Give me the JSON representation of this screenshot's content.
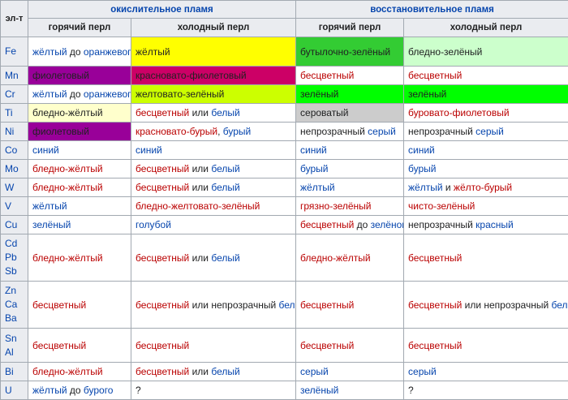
{
  "headers": {
    "element": "эл-т",
    "oxidizing": "окислительное пламя",
    "reducing": "восстановительное пламя",
    "hot": "горячий перл",
    "cold": "холодный перл"
  },
  "rows": [
    {
      "el": [
        "Fe"
      ],
      "h": 36,
      "cells": [
        {
          "bg": "#ffffff",
          "parts": [
            {
              "t": "жёлтый",
              "c": "b"
            },
            {
              "t": " до ",
              "c": "k"
            },
            {
              "t": "оранжевого",
              "c": "b"
            }
          ]
        },
        {
          "bg": "#ffff00",
          "parts": [
            {
              "t": "жёлтый",
              "c": "k"
            }
          ]
        },
        {
          "bg": "#33cc33",
          "parts": [
            {
              "t": "бутылочно-зелёный",
              "c": "k"
            }
          ]
        },
        {
          "bg": "#ccffcc",
          "parts": [
            {
              "t": "бледно-зелёный",
              "c": "k"
            }
          ]
        }
      ]
    },
    {
      "el": [
        "Mn"
      ],
      "h": 23,
      "cells": [
        {
          "bg": "#990099",
          "parts": [
            {
              "t": "фиолетовый",
              "c": "k"
            }
          ]
        },
        {
          "bg": "#cc0066",
          "parts": [
            {
              "t": "красновато-фиолетовый",
              "c": "k"
            }
          ]
        },
        {
          "bg": "#ffffff",
          "parts": [
            {
              "t": "бесцветный",
              "c": "r"
            }
          ]
        },
        {
          "bg": "#ffffff",
          "parts": [
            {
              "t": "бесцветный",
              "c": "r"
            }
          ]
        }
      ]
    },
    {
      "el": [
        "Cr"
      ],
      "h": 23,
      "cells": [
        {
          "bg": "#ffffff",
          "parts": [
            {
              "t": "жёлтый",
              "c": "b"
            },
            {
              "t": " до ",
              "c": "k"
            },
            {
              "t": "оранжевого",
              "c": "b"
            }
          ]
        },
        {
          "bg": "#ccff00",
          "parts": [
            {
              "t": "желтовато-зелёный",
              "c": "k"
            }
          ]
        },
        {
          "bg": "#00ff00",
          "parts": [
            {
              "t": "зелёный",
              "c": "k"
            }
          ]
        },
        {
          "bg": "#00ff00",
          "parts": [
            {
              "t": "зелёный",
              "c": "k"
            }
          ]
        }
      ]
    },
    {
      "el": [
        "Ti"
      ],
      "h": 23,
      "cells": [
        {
          "bg": "#ffffcc",
          "parts": [
            {
              "t": "бледно-жёлтый",
              "c": "k"
            }
          ]
        },
        {
          "bg": "#ffffff",
          "parts": [
            {
              "t": "бесцветный",
              "c": "r"
            },
            {
              "t": " или ",
              "c": "k"
            },
            {
              "t": "белый",
              "c": "b"
            }
          ]
        },
        {
          "bg": "#cccccc",
          "parts": [
            {
              "t": "сероватый",
              "c": "k"
            }
          ]
        },
        {
          "bg": "#ffffff",
          "parts": [
            {
              "t": "буровато-фиолетовый",
              "c": "r"
            }
          ]
        }
      ]
    },
    {
      "el": [
        "Ni"
      ],
      "h": 23,
      "cells": [
        {
          "bg": "#990099",
          "parts": [
            {
              "t": "фиолетовый",
              "c": "k"
            }
          ]
        },
        {
          "bg": "#ffffff",
          "parts": [
            {
              "t": "красновато-бурый",
              "c": "r"
            },
            {
              "t": ", ",
              "c": "k"
            },
            {
              "t": "бурый",
              "c": "b"
            }
          ]
        },
        {
          "bg": "#ffffff",
          "parts": [
            {
              "t": "непрозрачный ",
              "c": "k"
            },
            {
              "t": "серый",
              "c": "b"
            }
          ]
        },
        {
          "bg": "#ffffff",
          "parts": [
            {
              "t": "непрозрачный ",
              "c": "k"
            },
            {
              "t": "серый",
              "c": "b"
            }
          ]
        }
      ]
    },
    {
      "el": [
        "Co"
      ],
      "h": 23,
      "cells": [
        {
          "bg": "#ffffff",
          "parts": [
            {
              "t": "синий",
              "c": "b"
            }
          ]
        },
        {
          "bg": "#ffffff",
          "parts": [
            {
              "t": "синий",
              "c": "b"
            }
          ]
        },
        {
          "bg": "#ffffff",
          "parts": [
            {
              "t": "синий",
              "c": "b"
            }
          ]
        },
        {
          "bg": "#ffffff",
          "parts": [
            {
              "t": "синий",
              "c": "b"
            }
          ]
        }
      ]
    },
    {
      "el": [
        "Mo"
      ],
      "h": 23,
      "cells": [
        {
          "bg": "#ffffff",
          "parts": [
            {
              "t": "бледно-жёлтый",
              "c": "r"
            }
          ]
        },
        {
          "bg": "#ffffff",
          "parts": [
            {
              "t": "бесцветный",
              "c": "r"
            },
            {
              "t": " или ",
              "c": "k"
            },
            {
              "t": "белый",
              "c": "b"
            }
          ]
        },
        {
          "bg": "#ffffff",
          "parts": [
            {
              "t": "бурый",
              "c": "b"
            }
          ]
        },
        {
          "bg": "#ffffff",
          "parts": [
            {
              "t": "бурый",
              "c": "b"
            }
          ]
        }
      ]
    },
    {
      "el": [
        "W"
      ],
      "h": 23,
      "cells": [
        {
          "bg": "#ffffff",
          "parts": [
            {
              "t": "бледно-жёлтый",
              "c": "r"
            }
          ]
        },
        {
          "bg": "#ffffff",
          "parts": [
            {
              "t": "бесцветный",
              "c": "r"
            },
            {
              "t": " или ",
              "c": "k"
            },
            {
              "t": "белый",
              "c": "b"
            }
          ]
        },
        {
          "bg": "#ffffff",
          "parts": [
            {
              "t": "жёлтый",
              "c": "b"
            }
          ]
        },
        {
          "bg": "#ffffff",
          "parts": [
            {
              "t": "жёлтый",
              "c": "b"
            },
            {
              "t": " и ",
              "c": "k"
            },
            {
              "t": "жёлто-бурый",
              "c": "r"
            }
          ]
        }
      ]
    },
    {
      "el": [
        "V"
      ],
      "h": 23,
      "cells": [
        {
          "bg": "#ffffff",
          "parts": [
            {
              "t": "жёлтый",
              "c": "b"
            }
          ]
        },
        {
          "bg": "#ffffff",
          "parts": [
            {
              "t": "бледно-желтовато-зелёный",
              "c": "r"
            }
          ]
        },
        {
          "bg": "#ffffff",
          "parts": [
            {
              "t": "грязно-зелёный",
              "c": "r"
            }
          ]
        },
        {
          "bg": "#ffffff",
          "parts": [
            {
              "t": "чисто-зелёный",
              "c": "r"
            }
          ]
        }
      ]
    },
    {
      "el": [
        "Cu"
      ],
      "h": 23,
      "cells": [
        {
          "bg": "#ffffff",
          "parts": [
            {
              "t": "зелёный",
              "c": "b"
            }
          ]
        },
        {
          "bg": "#ffffff",
          "parts": [
            {
              "t": "голубой",
              "c": "b"
            }
          ]
        },
        {
          "bg": "#ffffff",
          "parts": [
            {
              "t": "бесцветный",
              "c": "r"
            },
            {
              "t": " до ",
              "c": "k"
            },
            {
              "t": "зелёного",
              "c": "b"
            }
          ]
        },
        {
          "bg": "#ffffff",
          "parts": [
            {
              "t": "непрозрачный ",
              "c": "k"
            },
            {
              "t": "красный",
              "c": "b"
            }
          ]
        }
      ]
    },
    {
      "el": [
        "Cd",
        "Pb",
        "Sb"
      ],
      "h": 58,
      "cells": [
        {
          "bg": "#ffffff",
          "parts": [
            {
              "t": "бледно-жёлтый",
              "c": "r"
            }
          ]
        },
        {
          "bg": "#ffffff",
          "parts": [
            {
              "t": "бесцветный",
              "c": "r"
            },
            {
              "t": " или ",
              "c": "k"
            },
            {
              "t": "белый",
              "c": "b"
            }
          ]
        },
        {
          "bg": "#ffffff",
          "parts": [
            {
              "t": "бледно-жёлтый",
              "c": "r"
            }
          ]
        },
        {
          "bg": "#ffffff",
          "parts": [
            {
              "t": "бесцветный",
              "c": "r"
            }
          ]
        }
      ]
    },
    {
      "el": [
        "Zn",
        "Ca",
        "Ba"
      ],
      "h": 58,
      "cells": [
        {
          "bg": "#ffffff",
          "parts": [
            {
              "t": "бесцветный",
              "c": "r"
            }
          ]
        },
        {
          "bg": "#ffffff",
          "parts": [
            {
              "t": "бесцветный",
              "c": "r"
            },
            {
              "t": " или непрозрачный ",
              "c": "k"
            },
            {
              "t": "белый",
              "c": "b"
            }
          ]
        },
        {
          "bg": "#ffffff",
          "parts": [
            {
              "t": "бесцветный",
              "c": "r"
            }
          ]
        },
        {
          "bg": "#ffffff",
          "parts": [
            {
              "t": "бесцветный",
              "c": "r"
            },
            {
              "t": " или непрозрачный ",
              "c": "k"
            },
            {
              "t": "белый",
              "c": "b"
            }
          ]
        }
      ]
    },
    {
      "el": [
        "Sn",
        "Al"
      ],
      "h": 42,
      "cells": [
        {
          "bg": "#ffffff",
          "parts": [
            {
              "t": "бесцветный",
              "c": "r"
            }
          ]
        },
        {
          "bg": "#ffffff",
          "parts": [
            {
              "t": "бесцветный",
              "c": "r"
            }
          ]
        },
        {
          "bg": "#ffffff",
          "parts": [
            {
              "t": "бесцветный",
              "c": "r"
            }
          ]
        },
        {
          "bg": "#ffffff",
          "parts": [
            {
              "t": "бесцветный",
              "c": "r"
            }
          ]
        }
      ]
    },
    {
      "el": [
        "Bi"
      ],
      "h": 23,
      "cells": [
        {
          "bg": "#ffffff",
          "parts": [
            {
              "t": "бледно-жёлтый",
              "c": "r"
            }
          ]
        },
        {
          "bg": "#ffffff",
          "parts": [
            {
              "t": "бесцветный",
              "c": "r"
            },
            {
              "t": " или ",
              "c": "k"
            },
            {
              "t": "белый",
              "c": "b"
            }
          ]
        },
        {
          "bg": "#ffffff",
          "parts": [
            {
              "t": "серый",
              "c": "b"
            }
          ]
        },
        {
          "bg": "#ffffff",
          "parts": [
            {
              "t": "серый",
              "c": "b"
            }
          ]
        }
      ]
    },
    {
      "el": [
        "U"
      ],
      "h": 23,
      "cells": [
        {
          "bg": "#ffffff",
          "parts": [
            {
              "t": "жёлтый",
              "c": "b"
            },
            {
              "t": " до ",
              "c": "k"
            },
            {
              "t": "бурого",
              "c": "b"
            }
          ]
        },
        {
          "bg": "#ffffff",
          "parts": [
            {
              "t": "?",
              "c": "k"
            }
          ]
        },
        {
          "bg": "#ffffff",
          "parts": [
            {
              "t": "зелёный",
              "c": "b"
            }
          ]
        },
        {
          "bg": "#ffffff",
          "parts": [
            {
              "t": "?",
              "c": "k"
            }
          ]
        }
      ]
    }
  ]
}
